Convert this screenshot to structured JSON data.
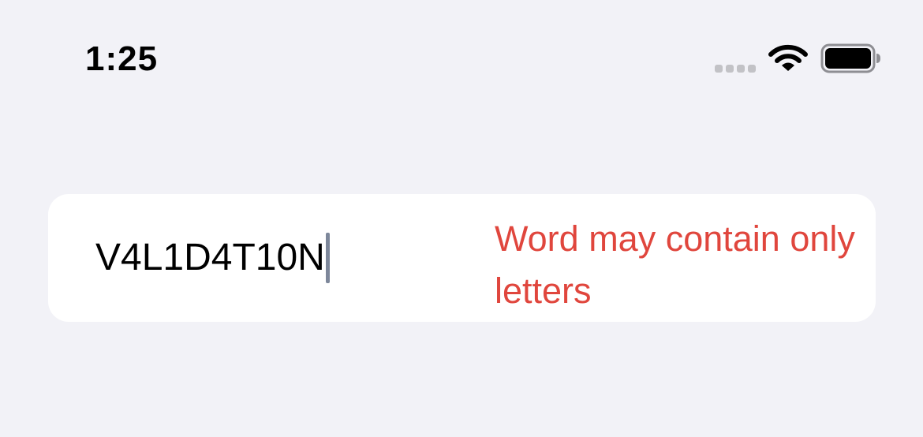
{
  "status_bar": {
    "time": "1:25",
    "signal_icon": "cellular-signal-icon",
    "wifi_icon": "wifi-icon",
    "battery_icon": "battery-icon"
  },
  "text_field": {
    "value": "V4L1D4T10N",
    "error_message": "Word may contain only letters"
  },
  "colors": {
    "background": "#f2f2f7",
    "card": "#ffffff",
    "error": "#e0463d",
    "cursor": "#7d879a"
  }
}
